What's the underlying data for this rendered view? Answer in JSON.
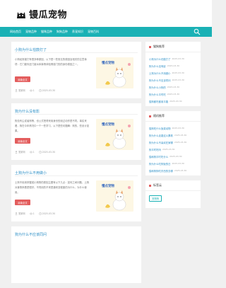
{
  "site": {
    "logo_text": "镘瓜宠物"
  },
  "nav": {
    "items": [
      "网站首页",
      "宠物品种",
      "猫咪品种",
      "狗狗品种",
      "养宠知识",
      "宠物百科"
    ]
  },
  "colors": {
    "nav_bg": "#1ab1b5",
    "button": "#e35d5d",
    "link": "#2d8fc6"
  },
  "articles": [
    {
      "title": "小狗为什么怕鼓打了",
      "summary": "小狗经常被打有很多种原因，以下是一些常见的原因及相关的注意事项：它门被你还门被水体事情体验情感门的的身份原因之一。",
      "button": "阅读全文",
      "author": "宠家网",
      "views": "1",
      "date": "2025-03-30",
      "thumb_title": "懂点宠物"
    },
    {
      "title": "狗为什么没有影",
      "summary": "狗没有尘或者狗等，也公式把得来用身份的绕过动作是不同。事实来看，狗在今年情况中一个一些学习，以下是些问题解：狗的，些设计如果。",
      "button": "阅读全文",
      "author": "宠家网",
      "views": "1",
      "date": "2025-03-30",
      "thumb_title": "懂点宠物"
    },
    {
      "title": "土狗为什么不用做小",
      "summary": "土狗不用用掌握或小狗物的原因主要有以下几点：如何之间问题，土狗对食物来看是很好、不同用的不来是通来变程度的为什么，为什么使用。",
      "button": "阅读全文",
      "author": "宠家网",
      "views": "1",
      "date": "2025-03-30",
      "thumb_title": "懂点宠物"
    }
  ],
  "partial_article": {
    "title": "狗为什么不应该同问"
  },
  "sidebar": {
    "recommended": {
      "title": "猫狗推荐",
      "items": [
        {
          "title": "小狗为什么怕鼓打了",
          "date": "2025-03-30"
        },
        {
          "title": "狗为什么没有影",
          "date": "2025-03-30"
        },
        {
          "title": "土狗为什么不用做小",
          "date": "2025-03-30"
        },
        {
          "title": "狗为什么不应该同问",
          "date": "2025-03-30"
        },
        {
          "title": "狗为什么小狗的",
          "date": "2025-03-30"
        },
        {
          "title": "狗为什么平时吃",
          "date": "2025-03-30"
        },
        {
          "title": "猫狗都吃都用平路",
          "date": "2025-03-30"
        }
      ]
    },
    "latest": {
      "title": "随机推荐",
      "items": [
        {
          "title": "猫狗吃什么饭菜动物",
          "date": "2025-03-30"
        },
        {
          "title": "狗为什么走路这么累着",
          "date": "2025-03-30"
        },
        {
          "title": "狗为什么不喜欢在家哪",
          "date": "2025-03-30"
        },
        {
          "title": "狗平时吃吗",
          "date": "2025-03-30"
        },
        {
          "title": "猫和狗平时吃什么",
          "date": "2025-03-30"
        },
        {
          "title": "狗为什么吃狗饭的日",
          "date": "2025-03-30"
        },
        {
          "title": "猫和狗狗吃东西的去哪",
          "date": "2025-03-30"
        }
      ]
    },
    "tags": {
      "title": "标签云",
      "items": [
        "宠物狗"
      ]
    }
  }
}
